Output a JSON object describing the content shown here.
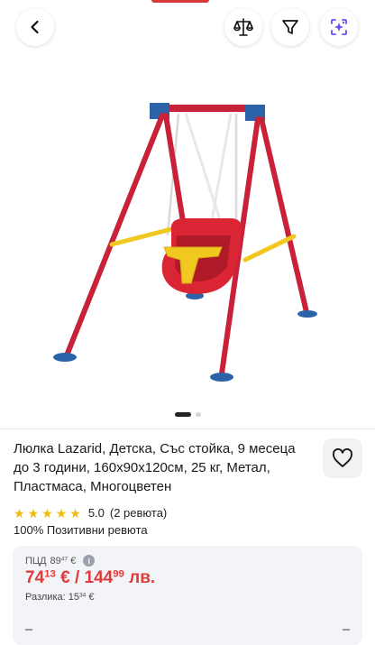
{
  "topbar": {
    "back_icon": "chevron-left-icon",
    "compare_icon": "scale-icon",
    "filter_icon": "filter-funnel-icon",
    "ai_icon": "sparkle-search-icon"
  },
  "gallery": {
    "image_alt": "swing-product-image",
    "slide_count": 2,
    "active_slide": 0
  },
  "product": {
    "title": "Люлка Lazarid, Детска, Със стойка, 9 месеца до 3 години, 160x90x120см, 25 кг, Метал, Пластмаса, Многоцветен",
    "rating_value": "5.0",
    "rating_count": "(2 ревюта)",
    "stars": 5,
    "positive_reviews": "100% Позитивни ревюта"
  },
  "pricing": {
    "rrp_label": "ПЦД",
    "rrp_int": "89",
    "rrp_dec": "47",
    "rrp_cur": "€",
    "price_eur_int": "74",
    "price_eur_dec": "13",
    "price_eur_cur": "€ /",
    "price_bgn_int": "144",
    "price_bgn_dec": "99",
    "price_bgn_cur": "лв.",
    "diff_label": "Разлика:",
    "diff_int": "15",
    "diff_dec": "34",
    "diff_cur": "€"
  },
  "colors": {
    "accent_red": "#e03a3a",
    "star_yellow": "#f2b90f",
    "ai_purple": "#6a4cf5"
  }
}
